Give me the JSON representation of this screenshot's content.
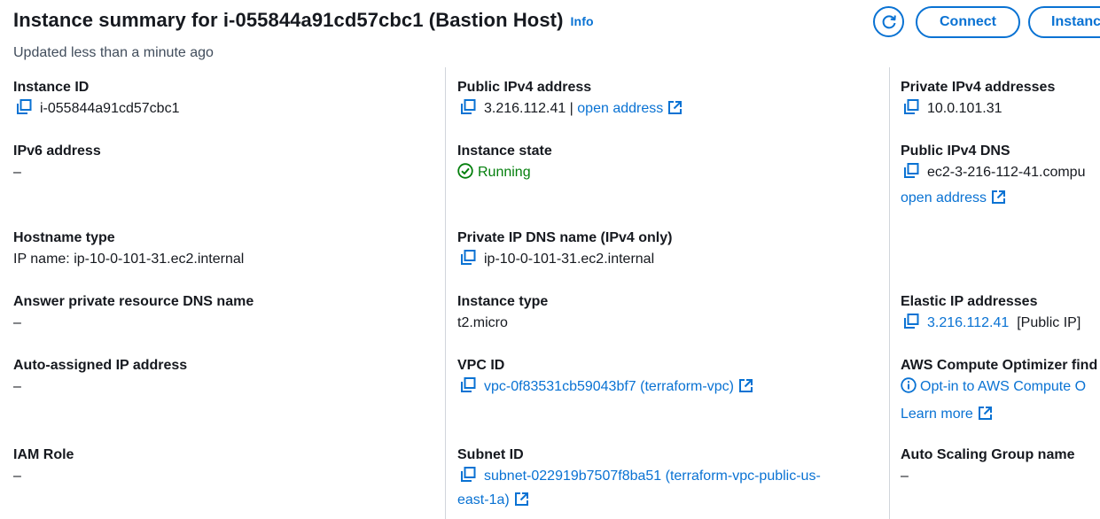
{
  "header": {
    "title": "Instance summary for i-055844a91cd57cbc1 (Bastion Host)",
    "info": "Info",
    "updated": "Updated less than a minute ago",
    "connect_label": "Connect",
    "state_label": "Instance state"
  },
  "col1": {
    "instance_id": {
      "label": "Instance ID",
      "value": "i-055844a91cd57cbc1"
    },
    "ipv6": {
      "label": "IPv6 address",
      "value": "–"
    },
    "hostname_type": {
      "label": "Hostname type",
      "value": "IP name: ip-10-0-101-31.ec2.internal"
    },
    "answer_dns": {
      "label": "Answer private resource DNS name",
      "value": "–"
    },
    "auto_ip": {
      "label": "Auto-assigned IP address",
      "value": "–"
    },
    "iam_role": {
      "label": "IAM Role",
      "value": "–"
    }
  },
  "col2": {
    "public_ipv4": {
      "label": "Public IPv4 address",
      "value": "3.216.112.41",
      "sep": " | ",
      "link": "open address"
    },
    "instance_state": {
      "label": "Instance state",
      "value": "Running"
    },
    "private_dns": {
      "label": "Private IP DNS name (IPv4 only)",
      "value": "ip-10-0-101-31.ec2.internal"
    },
    "instance_type": {
      "label": "Instance type",
      "value": "t2.micro"
    },
    "vpc_id": {
      "label": "VPC ID",
      "value": "vpc-0f83531cb59043bf7 (terraform-vpc)"
    },
    "subnet_id": {
      "label": "Subnet ID",
      "value_line1": "subnet-022919b7507f8ba51 (terraform-vpc-public-us-",
      "value_line2": "east-1a)"
    }
  },
  "col3": {
    "private_ipv4": {
      "label": "Private IPv4 addresses",
      "value": "10.0.101.31"
    },
    "public_dns": {
      "label": "Public IPv4 DNS",
      "value": "ec2-3-216-112-41.compu",
      "link": "open address"
    },
    "elastic_ip": {
      "label": "Elastic IP addresses",
      "value": "3.216.112.41",
      "suffix": "[Public IP]"
    },
    "optimizer": {
      "label": "AWS Compute Optimizer find",
      "link": "Opt-in to AWS Compute O",
      "learn": "Learn more"
    },
    "asg": {
      "label": "Auto Scaling Group name",
      "value": "–"
    }
  },
  "colors": {
    "link": "#0972d3",
    "success": "#037f0c",
    "text": "#16191f"
  }
}
